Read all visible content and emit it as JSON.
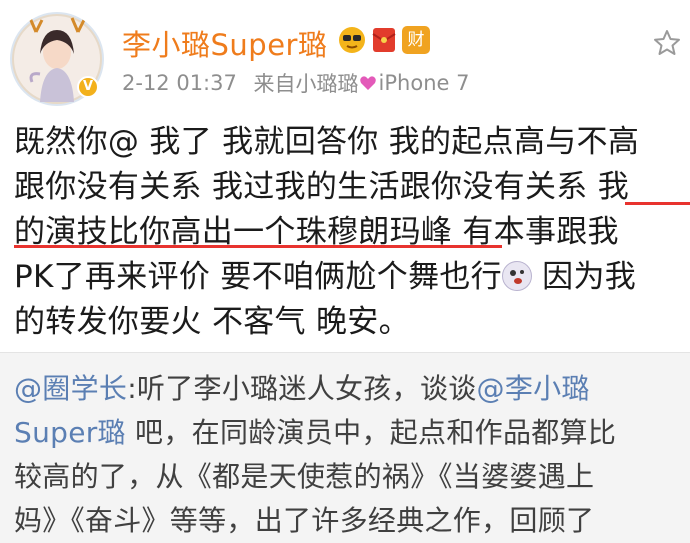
{
  "post": {
    "username": "李小璐Super璐",
    "timestamp": "2-12 01:37",
    "source_prefix": "来自小璐璐",
    "source_device": "iPhone 7",
    "badges": [
      "sunglasses-badge-icon",
      "red-envelope-icon",
      "wealth-badge-icon"
    ],
    "wealth_badge_text": "财",
    "text_lines": [
      "既然你@ 我了 我就回答你 我的起点高与不高",
      "跟你没有关系 我过我的生活跟你没有关系 我",
      "的演技比你高出一个珠穆朗玛峰 有本事跟我",
      {
        "before": "PK了再来评价 要不咱俩尬个舞也行",
        "after": " 因为我"
      },
      "的转发你要火 不客气 晚安。"
    ],
    "emoji": "crazy-face-emoji-icon"
  },
  "repost": {
    "line1": {
      "mention": "@圈学长",
      "text": ":听了李小璐迷人女孩，谈谈",
      "mention2": "@李小璐"
    },
    "line2": {
      "mention": "Super璐",
      "text": " 吧，在同龄演员中，起点和作品都算比"
    },
    "line3": "较高的了，从《都是天使惹的祸》《当婆婆遇上",
    "line4": "妈》《奋斗》等等，出了许多经典之作，回顾了"
  },
  "colors": {
    "username": "#ef7c1c",
    "meta": "#8e8e8e",
    "link": "#5b7fb3",
    "underline": "#e8332f",
    "repost_bg": "#f4f4f4"
  }
}
